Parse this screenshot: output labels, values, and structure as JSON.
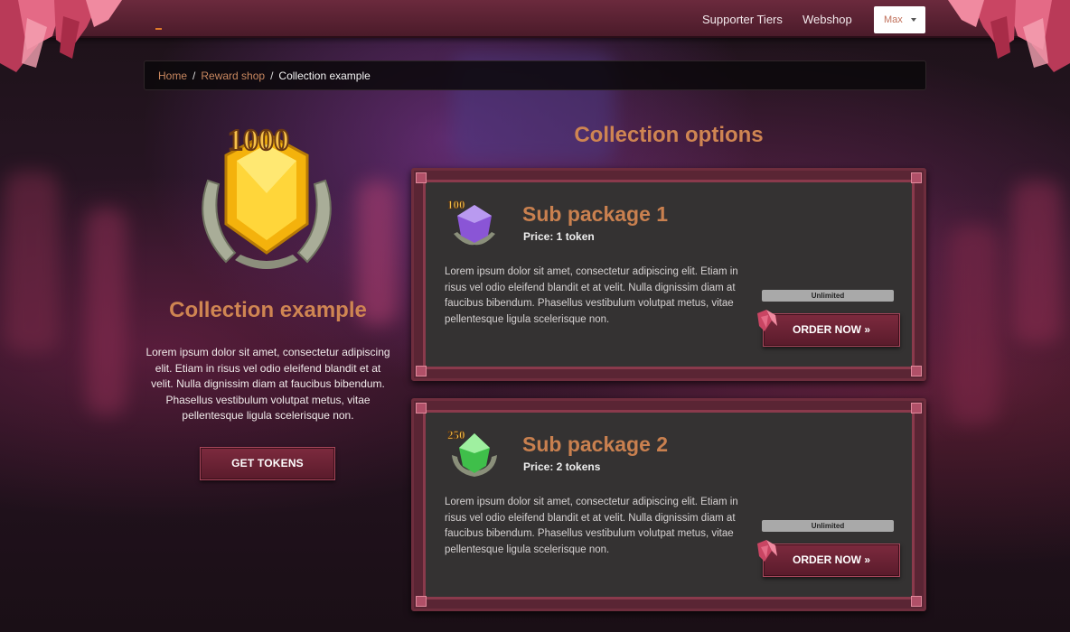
{
  "nav": {
    "links": [
      "Supporter Tiers",
      "Webshop"
    ],
    "user_label": "Max"
  },
  "breadcrumb": {
    "home": "Home",
    "reward_shop": "Reward shop",
    "current": "Collection example",
    "separator": "/"
  },
  "collection": {
    "badge_number": "1000",
    "title": "Collection example",
    "description": "Lorem ipsum dolor sit amet, consectetur adipiscing elit. Etiam in risus vel odio eleifend blandit et at velit. Nulla dignissim diam at faucibus bibendum. Phasellus vestibulum volutpat metus, vitae pellentesque ligula scelerisque non.",
    "get_tokens_label": "GET TOKENS"
  },
  "options": {
    "title": "Collection options",
    "packages": [
      {
        "icon_number": "100",
        "title": "Sub package 1",
        "price": "Price: 1 token",
        "description": "Lorem ipsum dolor sit amet, consectetur adipiscing elit. Etiam in risus vel odio eleifend blandit et at velit. Nulla dignissim diam at faucibus bibendum. Phasellus vestibulum volutpat metus, vitae pellentesque ligula scelerisque non.",
        "badge": "Unlimited",
        "order_label": "ORDER NOW »",
        "gem_color": "#8a55d6"
      },
      {
        "icon_number": "250",
        "title": "Sub package 2",
        "price": "Price: 2 tokens",
        "description": "Lorem ipsum dolor sit amet, consectetur adipiscing elit. Etiam in risus vel odio eleifend blandit et at velit. Nulla dignissim diam at faucibus bibendum. Phasellus vestibulum volutpat metus, vitae pellentesque ligula scelerisque non.",
        "badge": "Unlimited",
        "order_label": "ORDER NOW »",
        "gem_color": "#3fbf4a"
      }
    ]
  },
  "colors": {
    "accent": "#cf8552",
    "button": "#6b2235",
    "panel": "#343232"
  }
}
